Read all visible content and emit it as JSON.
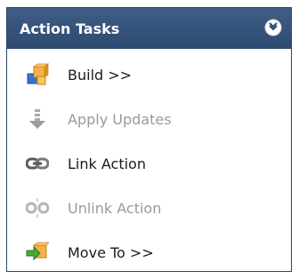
{
  "panel": {
    "title": "Action Tasks",
    "collapse_icon": "double-chevron-up-icon",
    "colors": {
      "header": "#345179",
      "text": "#1a1a1a",
      "disabled_text": "#9a9a9a"
    }
  },
  "items": [
    {
      "label": "Build >>",
      "icon": "build-blocks-icon",
      "enabled": true
    },
    {
      "label": "Apply Updates",
      "icon": "down-arrow-icon",
      "enabled": false
    },
    {
      "label": "Link Action",
      "icon": "link-chain-icon",
      "enabled": true
    },
    {
      "label": "Unlink Action",
      "icon": "broken-link-icon",
      "enabled": false
    },
    {
      "label": "Move To >>",
      "icon": "move-arrow-box-icon",
      "enabled": true
    }
  ]
}
